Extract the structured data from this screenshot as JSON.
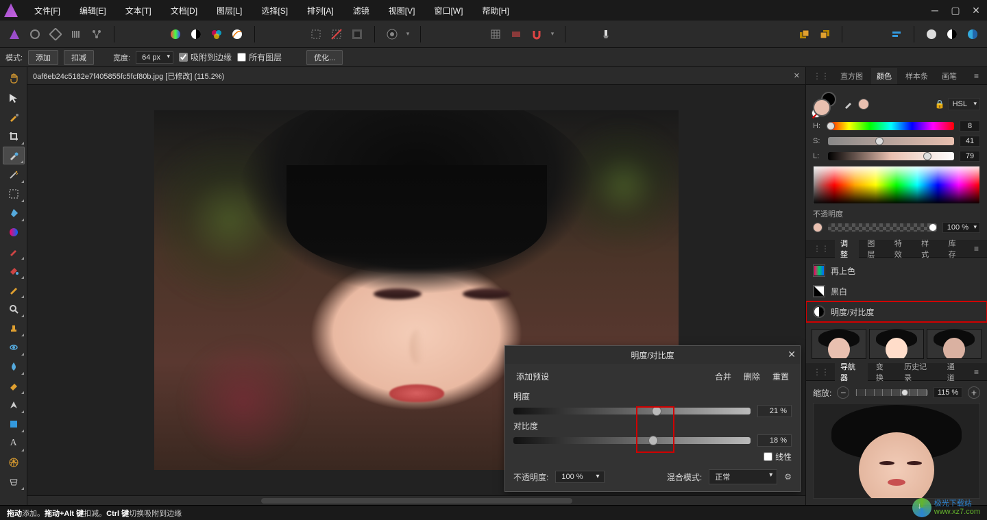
{
  "menu": {
    "file": "文件[F]",
    "edit": "编辑[E]",
    "text": "文本[T]",
    "document": "文档[D]",
    "layer": "图层[L]",
    "select": "选择[S]",
    "arrange": "排列[A]",
    "filter": "滤镜",
    "view": "视图[V]",
    "window": "窗口[W]",
    "help": "帮助[H]"
  },
  "options": {
    "mode_label": "模式:",
    "add": "添加",
    "subtract": "扣减",
    "width_label": "宽度:",
    "width_value": "64 px",
    "snap_edges": "吸附到边缘",
    "all_layers": "所有图层",
    "refine": "优化..."
  },
  "document": {
    "title": "0af6eb24c5182e7f405855fc5fcf80b.jpg [已修改] (115.2%)"
  },
  "color_panel": {
    "tabs": {
      "histogram": "直方图",
      "color": "颜色",
      "swatches": "样本条",
      "brushes": "画笔"
    },
    "mode": "HSL",
    "h_label": "H:",
    "h_value": "8",
    "s_label": "S:",
    "s_value": "41",
    "l_label": "L:",
    "l_value": "79",
    "opacity_label": "不透明度",
    "opacity_value": "100 %"
  },
  "adjust_panel": {
    "tabs": {
      "adjust": "调整",
      "layers": "图层",
      "effects": "特效",
      "styles": "样式",
      "stock": "库存"
    },
    "recolor": "再上色",
    "bw": "黑白",
    "brightness_contrast": "明度/对比度"
  },
  "dialog": {
    "title": "明度/对比度",
    "add_preset": "添加预设",
    "merge": "合并",
    "delete": "删除",
    "reset": "重置",
    "brightness_label": "明度",
    "brightness_value": "21 %",
    "contrast_label": "对比度",
    "contrast_value": "18 %",
    "linear": "线性",
    "opacity_label": "不透明度:",
    "opacity_value": "100 %",
    "blend_label": "混合模式:",
    "blend_value": "正常"
  },
  "navigator": {
    "tabs": {
      "navigator": "导航器",
      "transform": "变换",
      "history": "历史记录",
      "channels": "通道"
    },
    "zoom_label": "缩放:",
    "zoom_value": "115 %"
  },
  "statusbar": {
    "text_prefix": "拖动",
    "text_add": " 添加。",
    "text_alt": "拖动+Alt 键",
    "text_sub": " 扣减。",
    "text_ctrl": "Ctrl 键",
    "text_toggle": " 切换吸附到边缘"
  },
  "watermark": {
    "cn": "极光下载站",
    "url": "www.xz7.com"
  }
}
